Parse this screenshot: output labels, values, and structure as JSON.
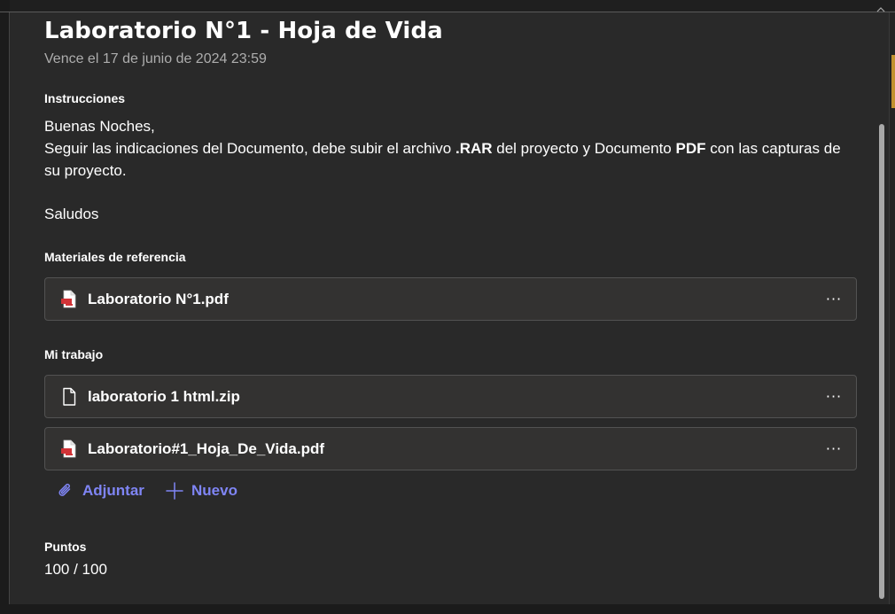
{
  "assignment": {
    "title": "Laboratorio N°1 - Hoja de Vida",
    "due": "Vence el 17 de junio de 2024 23:59"
  },
  "instructions": {
    "label": "Instrucciones",
    "greeting": "Buenas Noches,",
    "line_part1": "Seguir las indicaciones del Documento, debe subir el archivo ",
    "line_bold1": ".RAR",
    "line_part2": " del proyecto y Documento ",
    "line_bold2": "PDF",
    "line_part3": " con las capturas de su proyecto.",
    "closing": "Saludos"
  },
  "reference": {
    "label": "Materiales de referencia",
    "files": [
      {
        "name": "Laboratorio N°1.pdf",
        "icon": "pdf-file-icon"
      }
    ]
  },
  "my_work": {
    "label": "Mi trabajo",
    "files": [
      {
        "name": "laboratorio 1 html.zip",
        "icon": "document-file-icon"
      },
      {
        "name": "Laboratorio#1_Hoja_De_Vida.pdf",
        "icon": "pdf-file-icon"
      }
    ],
    "attach_label": "Adjuntar",
    "new_label": "Nuevo"
  },
  "points": {
    "label": "Puntos",
    "value": "100 / 100"
  },
  "more_options_glyph": "···",
  "colors": {
    "accent": "#7f85f5",
    "pdf_red": "#d13438",
    "panel": "#292929",
    "card": "#333231"
  }
}
